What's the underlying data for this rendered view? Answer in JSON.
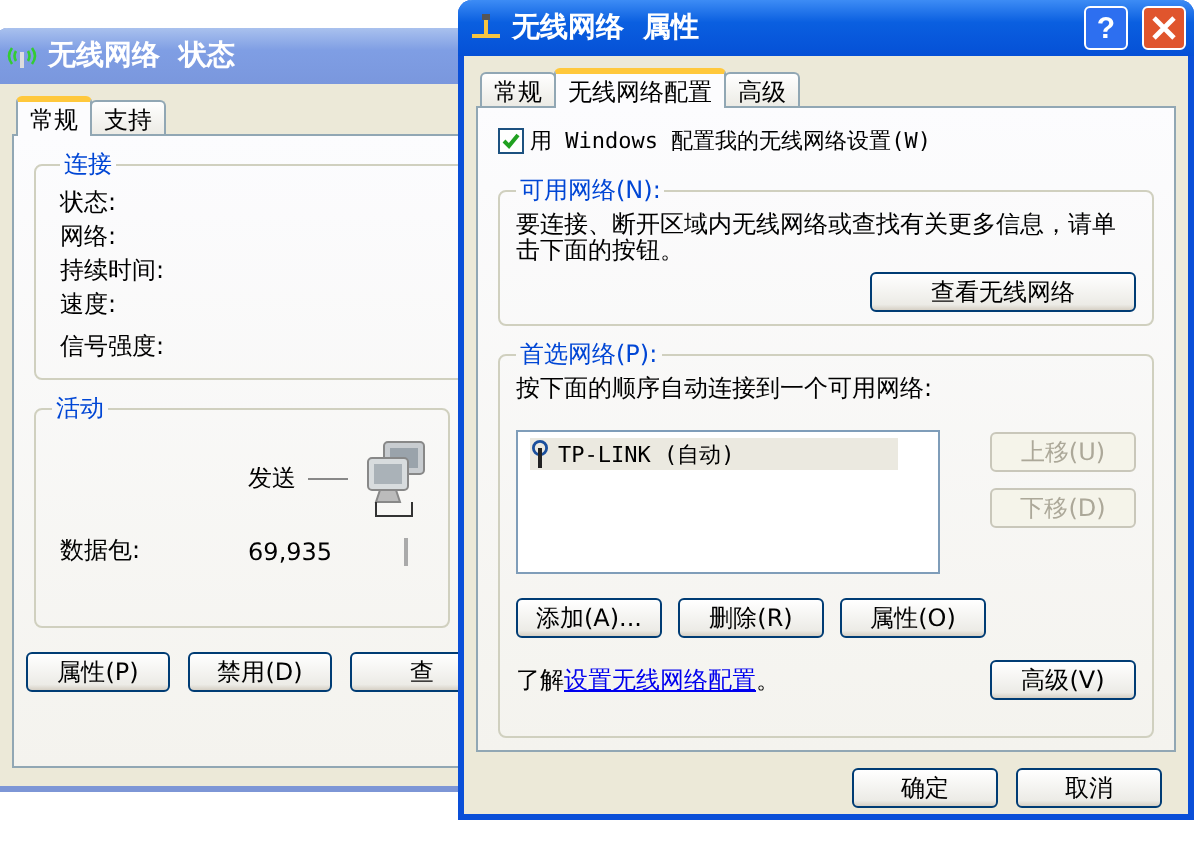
{
  "status_window": {
    "title": "无线网络  状态",
    "tabs": [
      {
        "label": "常规",
        "selected": true
      },
      {
        "label": "支持",
        "selected": false
      }
    ],
    "connection": {
      "title": "连接",
      "fields": [
        "状态:",
        "网络:",
        "持续时间:",
        "速度:",
        "信号强度:"
      ]
    },
    "activity": {
      "title": "活动",
      "sent_label": "发送",
      "packets_label": "数据包:",
      "packets_sent": "69,935"
    },
    "buttons": [
      "属性(P)",
      "禁用(D)",
      "查"
    ]
  },
  "properties_window": {
    "title": "无线网络  属性",
    "help_button": "?",
    "tabs": [
      {
        "label": "常规",
        "selected": false
      },
      {
        "label": "无线网络配置",
        "selected": true
      },
      {
        "label": "高级",
        "selected": false
      }
    ],
    "use_windows": {
      "label": "用 Windows 配置我的无线网络设置(W)",
      "checked": true
    },
    "available": {
      "title": "可用网络(N):",
      "text": "要连接、断开区域内无线网络或查找有关更多信息，请单击下面的按钮。",
      "button": "查看无线网络"
    },
    "preferred": {
      "title": "首选网络(P):",
      "text": "按下面的顺序自动连接到一个可用网络:",
      "networks": [
        {
          "name": "TP-LINK (自动)",
          "selected": true
        }
      ],
      "move_buttons": [
        {
          "label": "上移(U)",
          "disabled": true
        },
        {
          "label": "下移(D)",
          "disabled": true
        }
      ],
      "actions": [
        "添加(A)...",
        "删除(R)",
        "属性(O)"
      ],
      "learn_prefix": "了解",
      "learn_link": "设置无线网络配置",
      "learn_suffix": "。",
      "advanced_button": "高级(V)"
    },
    "buttons": [
      "确定",
      "取消"
    ]
  }
}
